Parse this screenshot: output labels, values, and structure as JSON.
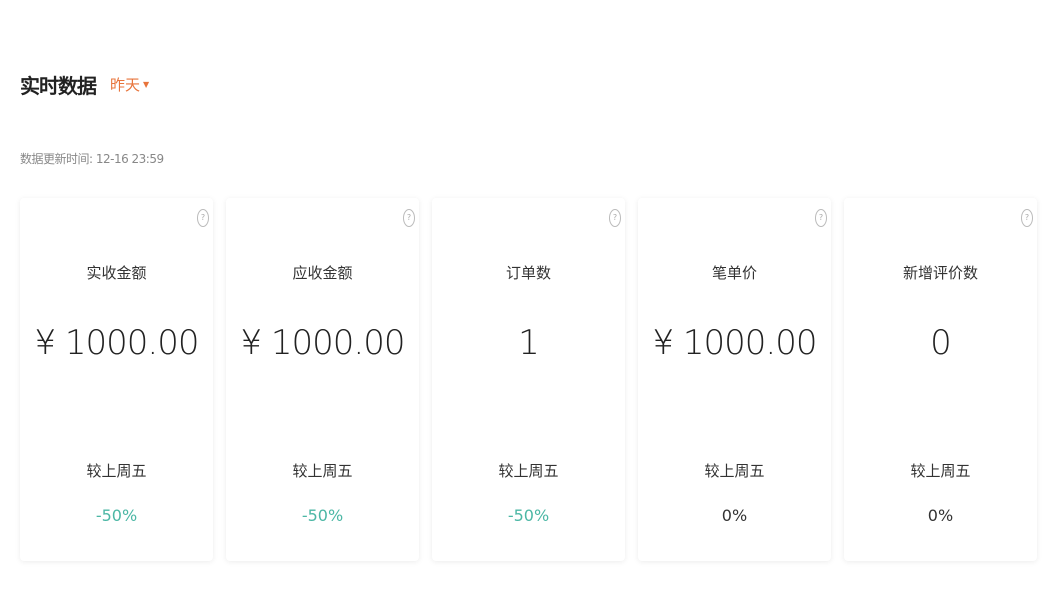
{
  "header": {
    "title": "实时数据",
    "date_select": "昨天"
  },
  "update_time": "数据更新时间: 12-16 23:59",
  "colors": {
    "accent": "#e8743b",
    "negative": "#4cb7a5"
  },
  "cards": [
    {
      "label": "实收金额",
      "value": "¥ 1000.00",
      "compare_label": "较上周五",
      "compare_value": "-50%"
    },
    {
      "label": "应收金额",
      "value": "¥ 1000.00",
      "compare_label": "较上周五",
      "compare_value": "-50%"
    },
    {
      "label": "订单数",
      "value": "1",
      "compare_label": "较上周五",
      "compare_value": "-50%"
    },
    {
      "label": "笔单价",
      "value": "¥ 1000.00",
      "compare_label": "较上周五",
      "compare_value": "0%"
    },
    {
      "label": "新增评价数",
      "value": "0",
      "compare_label": "较上周五",
      "compare_value": "0%"
    }
  ],
  "icons": {
    "help": "question-icon",
    "dropdown": "caret-down-icon"
  }
}
